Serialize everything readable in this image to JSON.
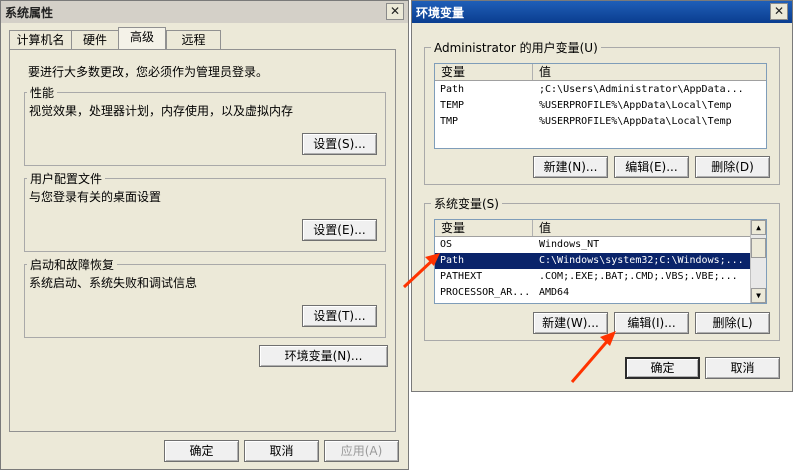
{
  "sys_props": {
    "title": "系统属性",
    "tabs": [
      {
        "label": "计算机名"
      },
      {
        "label": "硬件"
      },
      {
        "label": "高级"
      },
      {
        "label": "远程"
      }
    ],
    "admin_notice": "要进行大多数更改，您必须作为管理员登录。",
    "performance": {
      "title": "性能",
      "desc": "视觉效果，处理器计划，内存使用，以及虚拟内存",
      "button": "设置(S)..."
    },
    "user_profiles": {
      "title": "用户配置文件",
      "desc": "与您登录有关的桌面设置",
      "button": "设置(E)..."
    },
    "startup_recovery": {
      "title": "启动和故障恢复",
      "desc": "系统启动、系统失败和调试信息",
      "button": "设置(T)..."
    },
    "env_button": "环境变量(N)...",
    "ok": "确定",
    "cancel": "取消",
    "apply": "应用(A)"
  },
  "env_vars": {
    "title": "环境变量",
    "user_group_title": "Administrator 的用户变量(U)",
    "user_headers": {
      "var": "变量",
      "val": "值"
    },
    "user_rows": [
      {
        "var": "Path",
        "val": ";C:\\Users\\Administrator\\AppData..."
      },
      {
        "var": "TEMP",
        "val": "%USERPROFILE%\\AppData\\Local\\Temp"
      },
      {
        "var": "TMP",
        "val": "%USERPROFILE%\\AppData\\Local\\Temp"
      }
    ],
    "user_buttons": {
      "new": "新建(N)...",
      "edit": "编辑(E)...",
      "delete": "删除(D)"
    },
    "sys_group_title": "系统变量(S)",
    "sys_headers": {
      "var": "变量",
      "val": "值"
    },
    "sys_rows": [
      {
        "var": "OS",
        "val": "Windows_NT"
      },
      {
        "var": "Path",
        "val": "C:\\Windows\\system32;C:\\Windows;..."
      },
      {
        "var": "PATHEXT",
        "val": ".COM;.EXE;.BAT;.CMD;.VBS;.VBE;..."
      },
      {
        "var": "PROCESSOR_AR...",
        "val": "AMD64"
      }
    ],
    "sys_selected_index": 1,
    "sys_buttons": {
      "new": "新建(W)...",
      "edit": "编辑(I)...",
      "delete": "删除(L)"
    },
    "ok": "确定",
    "cancel": "取消"
  },
  "colors": {
    "annotation_arrow": "#ff3300",
    "selection": "#0a246a"
  }
}
